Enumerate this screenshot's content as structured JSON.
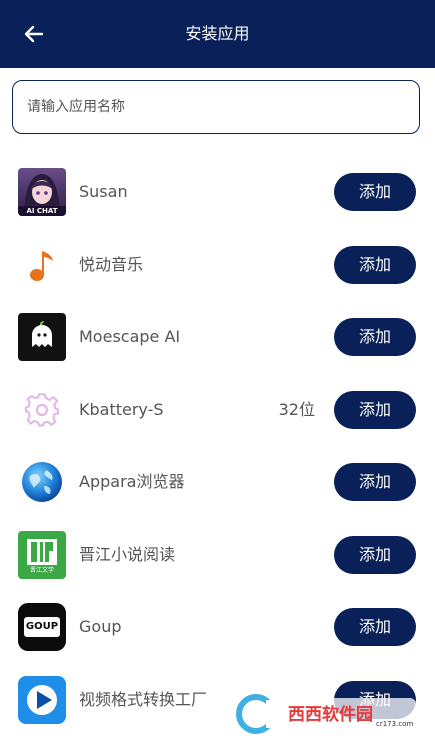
{
  "header": {
    "title": "安装应用",
    "back_icon": "arrow-left-icon"
  },
  "search": {
    "placeholder": "请输入应用名称",
    "value": ""
  },
  "apps": [
    {
      "name": "Susan",
      "extra": "",
      "add_label": "添加",
      "icon_text": "AI CHAT"
    },
    {
      "name": "悦动音乐",
      "extra": "",
      "add_label": "添加"
    },
    {
      "name": "Moescape AI",
      "extra": "",
      "add_label": "添加"
    },
    {
      "name": "Kbattery-S",
      "extra": "32位",
      "add_label": "添加"
    },
    {
      "name": "Appara浏览器",
      "extra": "",
      "add_label": "添加"
    },
    {
      "name": "晋江小说阅读",
      "extra": "",
      "add_label": "添加",
      "icon_text": "晋江文学"
    },
    {
      "name": "Goup",
      "extra": "",
      "add_label": "添加",
      "icon_text": "GOUP"
    },
    {
      "name": "视频格式转换工厂",
      "extra": "",
      "add_label": "添加"
    }
  ],
  "watermark": {
    "brand": "西西软件园",
    "url": "cr173.com"
  },
  "colors": {
    "primary": "#092158",
    "text": "#555555"
  }
}
